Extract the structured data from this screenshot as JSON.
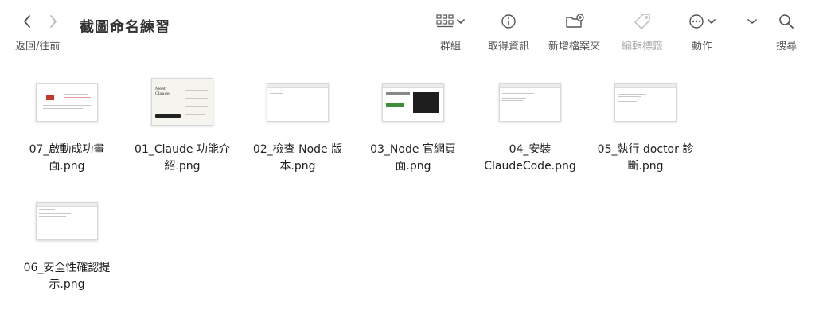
{
  "nav": {
    "back_label": "返回/往前"
  },
  "folder_title": "截圖命名練習",
  "toolbar": {
    "group_label": "群組",
    "info_label": "取得資訊",
    "new_folder_label": "新增檔案夾",
    "edit_tags_label": "編輯標籤",
    "action_label": "動作",
    "search_label": "搜尋"
  },
  "files": [
    {
      "name_line1": "07_啟動成功畫",
      "name_line2": "面.png"
    },
    {
      "name_line1": "01_Claude 功能介",
      "name_line2": "紹.png"
    },
    {
      "name_line1": "02_檢查 Node 版",
      "name_line2": "本.png"
    },
    {
      "name_line1": "03_Node 官網頁",
      "name_line2": "面.png"
    },
    {
      "name_line1": "04_安裝",
      "name_line2": "ClaudeCode.png"
    },
    {
      "name_line1": "05_執行 doctor 診",
      "name_line2": "斷.png"
    },
    {
      "name_line1": "06_安全性確認提",
      "name_line2": "示.png"
    }
  ],
  "thumbs": {
    "claude_heading": "Meet Claude"
  },
  "colors": {
    "accent_red": "#c0392b",
    "thumb_dark": "#1e1e1e",
    "thumb_green": "#3c8d3c"
  },
  "icons": [
    "chevron-left-icon",
    "chevron-right-icon",
    "grid-view-icon",
    "info-icon",
    "new-folder-icon",
    "tag-icon",
    "more-icon",
    "search-icon"
  ]
}
